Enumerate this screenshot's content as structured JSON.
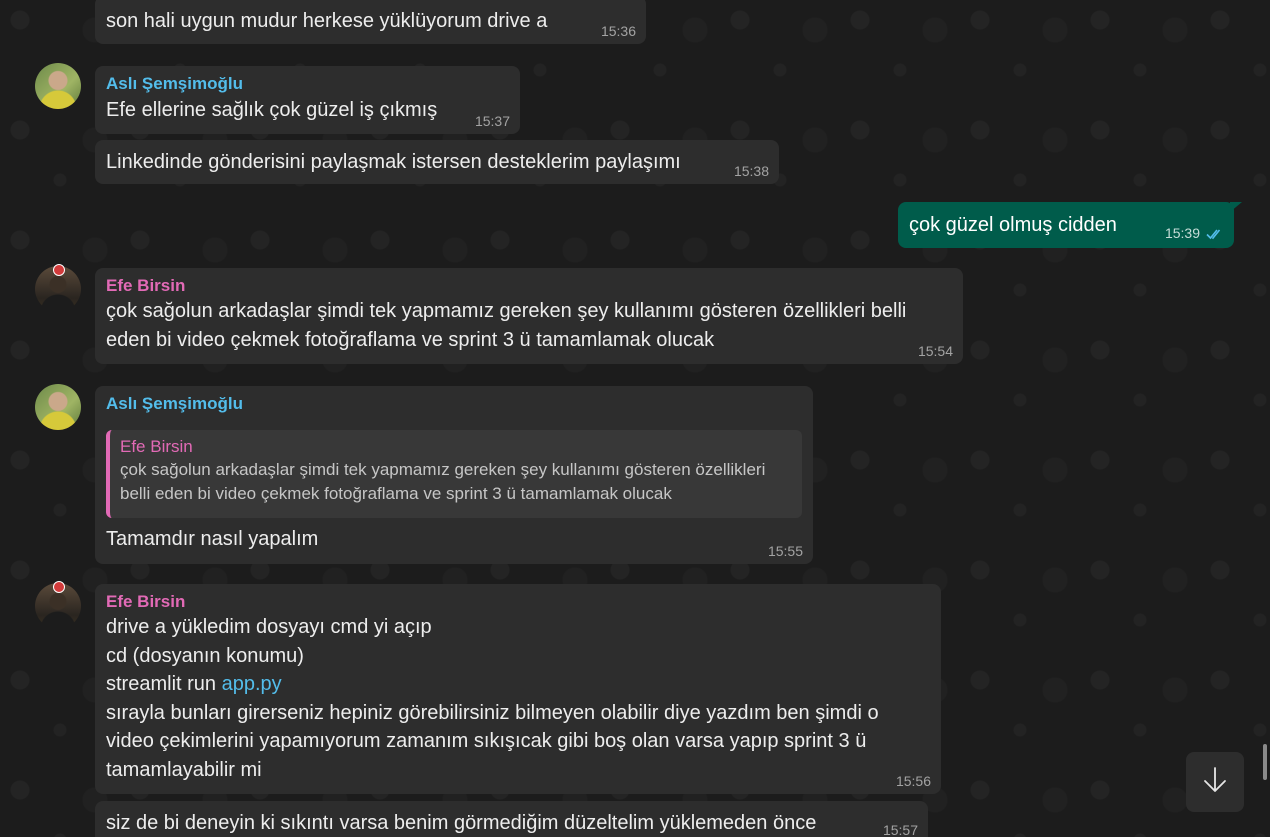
{
  "messages": [
    {
      "text": "son hali uygun mudur herkese yüklüyorum drive a",
      "time": "15:36"
    },
    {
      "sender": "Aslı Şemşimoğlu",
      "text": "Efe ellerine sağlık çok güzel iş çıkmış",
      "time": "15:37"
    },
    {
      "text": "Linkedinde gönderisini paylaşmak istersen desteklerim paylaşımı",
      "time": "15:38"
    },
    {
      "text": "çok güzel olmuş cidden",
      "time": "15:39",
      "status": "read"
    },
    {
      "sender": "Efe Birsin",
      "text": "çok sağolun arkadaşlar şimdi tek yapmamız gereken şey kullanımı gösteren özellikleri belli eden bi video çekmek fotoğraflama ve sprint 3 ü tamamlamak olucak",
      "time": "15:54"
    },
    {
      "sender": "Aslı Şemşimoğlu",
      "quote": {
        "sender": "Efe Birsin",
        "text": "çok sağolun arkadaşlar şimdi tek yapmamız gereken şey kullanımı gösteren özellikleri belli eden bi video çekmek fotoğraflama ve sprint 3 ü tamamlamak olucak"
      },
      "text": "Tamamdır nasıl yapalım",
      "time": "15:55"
    },
    {
      "sender": "Efe Birsin",
      "line1": "drive a yükledim dosyayı cmd yi açıp",
      "line2": "cd (dosyanın konumu)",
      "line3_prefix": "streamlit run ",
      "line3_link": "app.py",
      "line4": "sırayla bunları girerseniz hepiniz görebilirsiniz bilmeyen olabilir diye yazdım ben şimdi o video çekimlerini yapamıyorum zamanım sıkışıcak gibi boş olan varsa yapıp sprint 3 ü tamamlayabilir mi",
      "time": "15:56"
    },
    {
      "text": "siz de bi deneyin ki sıkıntı varsa benim görmediğim düzeltelim yüklemeden önce",
      "time": "15:57"
    }
  ],
  "icons": {
    "read_receipt": "double-check-icon",
    "scroll_down": "arrow-down-icon"
  },
  "colors": {
    "incoming_bubble": "#2d2d2d",
    "outgoing_bubble": "#005c4b",
    "sender_asli": "#53bdeb",
    "sender_efe": "#e26ab6",
    "read_tick": "#53bdeb"
  }
}
